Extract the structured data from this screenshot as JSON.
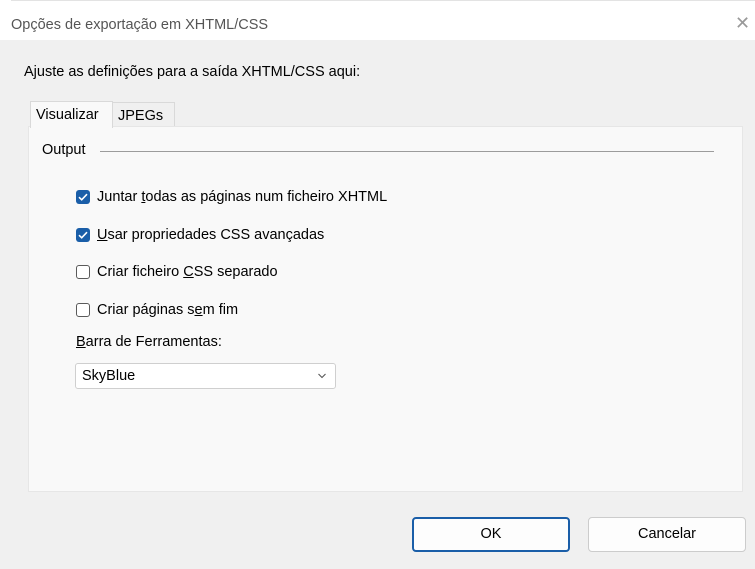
{
  "window": {
    "title": "Opções de exportação em XHTML/CSS",
    "close_glyph": "✕"
  },
  "instructions": "Ajuste as definições para a saída XHTML/CSS aqui:",
  "tabs": [
    {
      "label": "Visualizar",
      "selected": true
    },
    {
      "label": "JPEGs",
      "selected": false
    }
  ],
  "output_group": {
    "label": "Output",
    "checkboxes": [
      {
        "pre": "Juntar ",
        "accel": "t",
        "post": "odas as páginas num ficheiro XHTML",
        "checked": true
      },
      {
        "pre": "",
        "accel": "U",
        "post": "sar propriedades CSS avançadas",
        "checked": true
      },
      {
        "pre": "Criar ficheiro ",
        "accel": "C",
        "post": "SS separado",
        "checked": false
      },
      {
        "pre": "Criar páginas s",
        "accel": "e",
        "post": "m fim",
        "checked": false
      }
    ],
    "toolbar_label": {
      "pre": "",
      "accel": "B",
      "post": "arra de Ferramentas:"
    },
    "toolbar_select": {
      "value": "SkyBlue"
    }
  },
  "buttons": {
    "ok": "OK",
    "cancel": "Cancelar"
  },
  "colors": {
    "accent": "#1a5ea8",
    "panel": "#f9f9f9",
    "background": "#f0f0f0"
  },
  "icons": {
    "close": "close-icon",
    "check": "checkmark-icon",
    "dropdown": "chevron-down-icon"
  }
}
